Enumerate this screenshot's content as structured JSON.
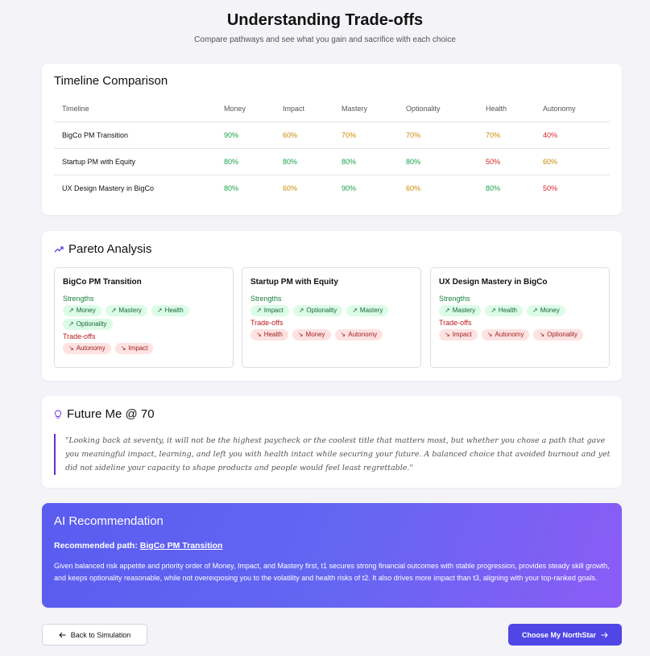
{
  "header": {
    "title": "Understanding Trade-offs",
    "subtitle": "Compare pathways and see what you gain and sacrifice with each choice"
  },
  "timeline": {
    "title": "Timeline Comparison",
    "columns": [
      "Timeline",
      "Money",
      "Impact",
      "Mastery",
      "Optionality",
      "Health",
      "Autonomy"
    ],
    "rows": [
      {
        "name": "BigCo PM Transition",
        "values": [
          "90%",
          "60%",
          "70%",
          "70%",
          "70%",
          "40%"
        ],
        "levels": [
          "g",
          "o",
          "o",
          "o",
          "o",
          "r"
        ]
      },
      {
        "name": "Startup PM with Equity",
        "values": [
          "80%",
          "80%",
          "80%",
          "80%",
          "50%",
          "60%"
        ],
        "levels": [
          "g",
          "g",
          "g",
          "g",
          "r",
          "o"
        ]
      },
      {
        "name": "UX Design Mastery in BigCo",
        "values": [
          "80%",
          "60%",
          "90%",
          "60%",
          "80%",
          "50%"
        ],
        "levels": [
          "g",
          "o",
          "g",
          "o",
          "g",
          "r"
        ]
      }
    ]
  },
  "pareto": {
    "title": "Pareto Analysis",
    "strengths_label": "Strengths",
    "tradeoffs_label": "Trade-offs",
    "cards": [
      {
        "name": "BigCo PM Transition",
        "strengths": [
          "Money",
          "Mastery",
          "Health",
          "Optionality"
        ],
        "tradeoffs": [
          "Autonomy",
          "Impact"
        ]
      },
      {
        "name": "Startup PM with Equity",
        "strengths": [
          "Impact",
          "Optionality",
          "Mastery"
        ],
        "tradeoffs": [
          "Health",
          "Money",
          "Autonomy"
        ]
      },
      {
        "name": "UX Design Mastery in BigCo",
        "strengths": [
          "Mastery",
          "Health",
          "Money"
        ],
        "tradeoffs": [
          "Impact",
          "Autonomy",
          "Optionality"
        ]
      }
    ]
  },
  "future": {
    "title": "Future Me @ 70",
    "quote": "\"Looking back at seventy, it will not be the highest paycheck or the coolest title that matters most, but whether you chose a path that gave you meaningful impact, learning, and left you with health intact while securing your future. A balanced choice that avoided burnout and yet did not sideline your capacity to shape products and people would feel least regrettable.\""
  },
  "ai": {
    "title": "AI Recommendation",
    "rec_label": "Recommended path:",
    "rec_path": "BigCo PM Transition",
    "body": "Given balanced risk appetite and priority order of Money, Impact, and Mastery first, t1 secures strong financial outcomes with stable progression, provides steady skill growth, and keeps optionality reasonable, while not overexposing you to the volatility and health risks of t2. It also drives more impact than t3, aligning with your top-ranked goals."
  },
  "buttons": {
    "back": "Back to Simulation",
    "choose": "Choose My NorthStar"
  },
  "colors": {
    "good": "#16a34a",
    "medium": "#ca8a04",
    "low": "#dc2626",
    "accent": "#4f46e5"
  }
}
